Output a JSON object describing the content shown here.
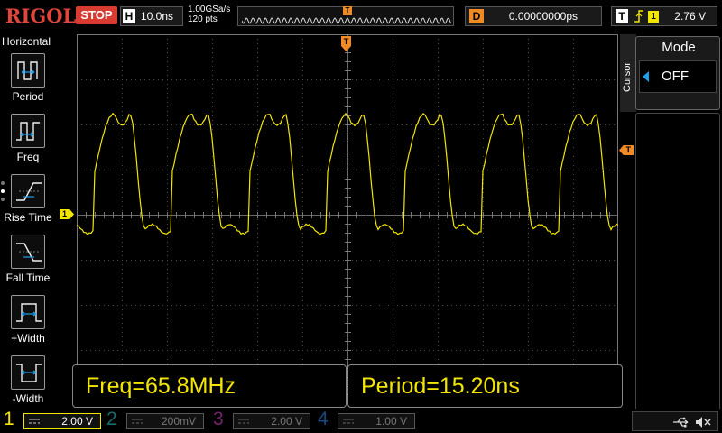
{
  "brand": "RIGOL",
  "run_state": "STOP",
  "horizontal": {
    "tag": "H",
    "timebase": "10.0ns",
    "sample_rate": "1.00GSa/s",
    "points": "120 pts"
  },
  "memory": {
    "marker": "T"
  },
  "delay": {
    "tag": "D",
    "value": "0.00000000ps"
  },
  "trigger": {
    "tag": "T",
    "source": "1",
    "level": "2.76 V",
    "edge_icon": "rising-edge-icon"
  },
  "left_menu": {
    "title": "Horizontal",
    "items": [
      {
        "label": "Period",
        "icon": "period-icon"
      },
      {
        "label": "Freq",
        "icon": "freq-icon"
      },
      {
        "label": "Rise Time",
        "icon": "rise-time-icon"
      },
      {
        "label": "Fall Time",
        "icon": "fall-time-icon"
      },
      {
        "label": "+Width",
        "icon": "pos-width-icon"
      },
      {
        "label": "-Width",
        "icon": "neg-width-icon"
      }
    ]
  },
  "markers": {
    "ch1": "1",
    "trigger_pos": "T",
    "trigger_level": "T"
  },
  "measurements": {
    "freq": "Freq=65.8MHz",
    "period": "Period=15.20ns"
  },
  "cursor_panel": {
    "tab": "Cursor",
    "title": "Mode",
    "value": "OFF"
  },
  "channels": [
    {
      "num": "1",
      "scale": "2.00 V",
      "color": "#f2e600",
      "enabled": true
    },
    {
      "num": "2",
      "scale": "200mV",
      "color": "#27b3b3",
      "enabled": false
    },
    {
      "num": "3",
      "scale": "2.00 V",
      "color": "#c03ab2",
      "enabled": false
    },
    {
      "num": "4",
      "scale": "1.00 V",
      "color": "#2a7bd6",
      "enabled": false
    }
  ],
  "status_icons": [
    "usb-icon",
    "mute-icon"
  ],
  "colors": {
    "trace": "#f2e600",
    "trigger": "#f08a24",
    "stop": "#d83b30",
    "logo": "#e0463a"
  }
}
